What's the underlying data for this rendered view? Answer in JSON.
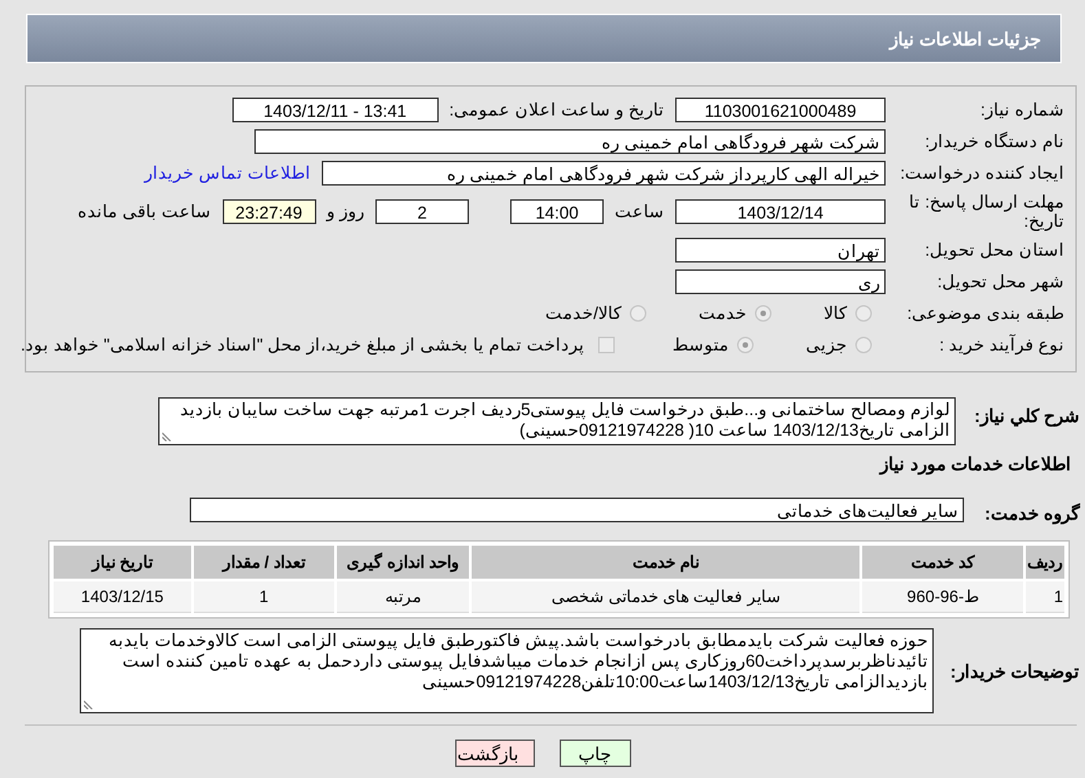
{
  "page_title": "جزئیات اطلاعات نیاز",
  "need_number": {
    "label": "شماره نیاز:",
    "value": "1103001621000489"
  },
  "announce": {
    "label": "تاریخ و ساعت اعلان عمومی:",
    "value": "1403/12/11 - 13:41"
  },
  "buyer_org": {
    "label": "نام دستگاه خریدار:",
    "value": "شرکت شهر فرودگاهی امام خمینی  ره"
  },
  "requester": {
    "label": "ایجاد کننده درخواست:",
    "value": "خیراله الهی کارپرداز شرکت شهر فرودگاهی امام خمینی  ره",
    "link": "اطلاعات تماس خریدار"
  },
  "deadline": {
    "label": "مهلت ارسال پاسخ: تا تاریخ:",
    "date": "1403/12/14",
    "time_label": "ساعت",
    "time": "14:00",
    "days": "2",
    "days_label": "روز و",
    "remaining": "23:27:49",
    "remaining_label": "ساعت باقی مانده"
  },
  "province": {
    "label": "استان محل تحویل:",
    "value": "تهران"
  },
  "city": {
    "label": "شهر محل تحویل:",
    "value": "ری"
  },
  "category": {
    "label": "طبقه بندی موضوعی:",
    "options": [
      {
        "label": "کالا",
        "selected": false
      },
      {
        "label": "خدمت",
        "selected": true
      },
      {
        "label": "کالا/خدمت",
        "selected": false
      }
    ]
  },
  "purchase_type": {
    "label": "نوع فرآیند خرید :",
    "options": [
      {
        "label": "جزیی",
        "selected": false
      },
      {
        "label": "متوسط",
        "selected": true
      }
    ],
    "treasury": {
      "label": "پرداخت تمام یا بخشی از مبلغ خرید،از محل \"اسناد خزانه اسلامی\" خواهد بود.",
      "checked": false
    }
  },
  "description": {
    "label": "شرح کلي نياز:",
    "value": "لوازم ومصالح ساختمانی و...طبق درخواست فایل پیوستی5ردیف اجرت 1مرتبه جهت ساخت سایبان بازدید الزامی تاریخ1403/12/13 ساعت 10( 09121974228حسینی)"
  },
  "services_heading": "اطلاعات خدمات مورد نیاز",
  "service_group": {
    "label": "گروه خدمت:",
    "value": "سایر فعالیت‌های خدماتی"
  },
  "table": {
    "columns": [
      "ردیف",
      "کد خدمت",
      "نام خدمت",
      "واحد اندازه گیری",
      "تعداد / مقدار",
      "تاریخ نیاز"
    ],
    "rows": [
      [
        "1",
        "ط-96-960",
        "سایر فعالیت های خدماتی شخصی",
        "مرتبه",
        "1",
        "1403/12/15"
      ]
    ]
  },
  "buyer_notes": {
    "label": "توضیحات خریدار:",
    "value": "حوزه فعالیت شرکت بایدمطابق بادرخواست باشد.پیش فاکتورطبق فایل پیوستی الزامی است کالاوخدمات بایدبه تائیدناظربرسدپرداخت60روزکاری پس ازانجام خدمات میباشدفایل پیوستی داردحمل به عهده تامین کننده است بازدیدالزامی تاریخ1403/12/13ساعت10:00تلفن09121974228حسینی"
  },
  "buttons": [
    {
      "label": "چاپ",
      "kind": "print"
    },
    {
      "label": "بازگشت",
      "kind": "back"
    }
  ]
}
